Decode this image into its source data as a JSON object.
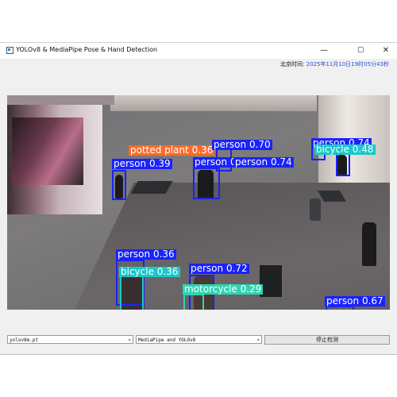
{
  "window": {
    "title": "YOLOv8 & MediaPipe Pose & Hand Detection",
    "controls": {
      "minimize": "—",
      "maximize": "☐",
      "close": "✕"
    }
  },
  "clock": {
    "label": "北京时间: ",
    "value": "2025年11月10日19时05分43秒"
  },
  "detections": [
    {
      "label": "potted plant 0.36",
      "color": "#ff6a2a"
    },
    {
      "label": "person 0.70",
      "color": "#1a22ff"
    },
    {
      "label": "person 0.39",
      "color": "#1a22ff"
    },
    {
      "label": "person 0.80",
      "color": "#1a22ff"
    },
    {
      "label": "person 0.74",
      "color": "#1a22ff"
    },
    {
      "label": "person 0.74",
      "color": "#1a22ff"
    },
    {
      "label": "bicycle 0.48",
      "color": "#19c8c8"
    },
    {
      "label": "person 0.36",
      "color": "#1a22ff"
    },
    {
      "label": "bicycle 0.36",
      "color": "#19c8c8"
    },
    {
      "label": "person 0.72",
      "color": "#1a22ff"
    },
    {
      "label": "motorcycle 0.29",
      "color": "#2fd4b0"
    },
    {
      "label": "person 0.67",
      "color": "#1a22ff"
    }
  ],
  "controls": {
    "model_select": "yolov8m.pt",
    "mode_select": "MediaPipe and YOLOv8",
    "stop_button": "停止检测"
  }
}
